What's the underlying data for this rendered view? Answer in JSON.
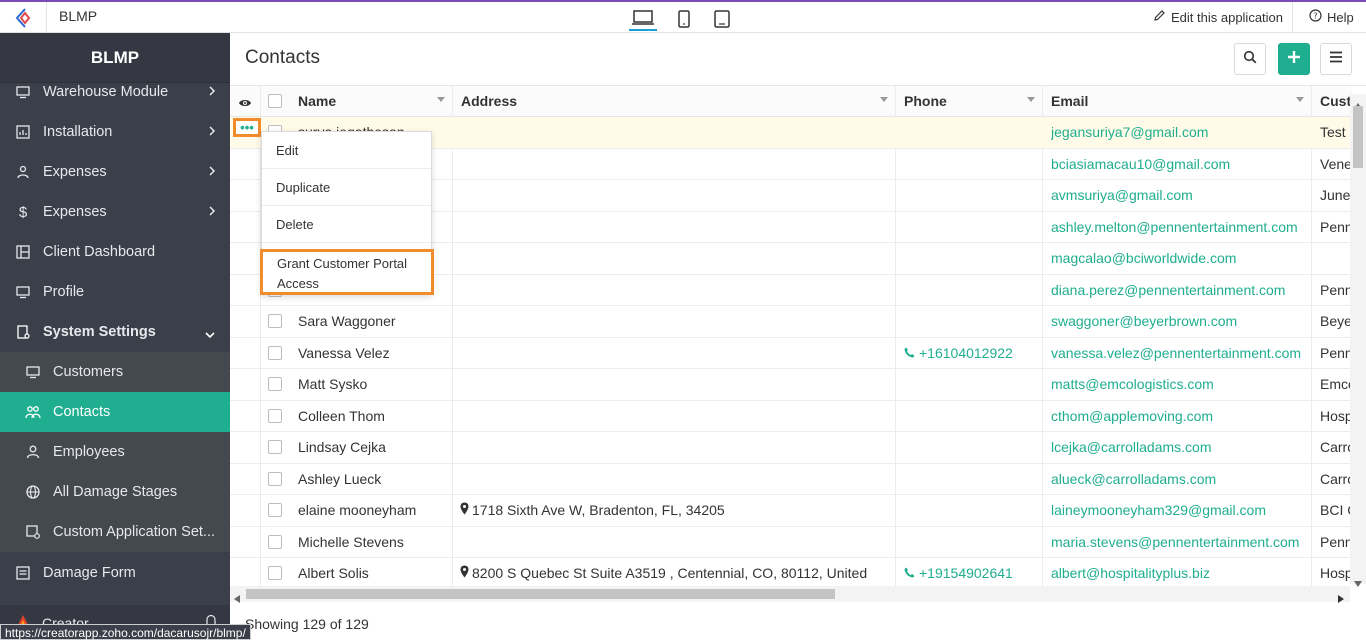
{
  "app": {
    "name": "BLMP",
    "edit_label": "Edit this application",
    "help_label": "Help"
  },
  "sidebar": {
    "brand": "BLMP",
    "items": [
      {
        "label": "Warehouse Module",
        "icon": "monitor-icon"
      },
      {
        "label": "Installation",
        "icon": "chart-icon"
      },
      {
        "label": "Expenses",
        "icon": "people-icon"
      },
      {
        "label": "Expenses",
        "icon": "dollar-icon"
      },
      {
        "label": "Client Dashboard",
        "icon": "dashboard-icon"
      },
      {
        "label": "Profile",
        "icon": "monitor-icon"
      },
      {
        "label": "System Settings",
        "icon": "settings-doc-icon"
      },
      {
        "label": "Customers",
        "icon": "monitor-icon"
      },
      {
        "label": "Contacts",
        "icon": "contacts-icon"
      },
      {
        "label": "Employees",
        "icon": "user-icon"
      },
      {
        "label": "All Damage Stages",
        "icon": "globe-icon"
      },
      {
        "label": "Custom Application Set...",
        "icon": "settings-icon"
      },
      {
        "label": "Damage Form",
        "icon": "form-icon"
      }
    ],
    "creator_label": "Creator"
  },
  "page": {
    "title": "Contacts",
    "footer": "Showing 129 of 129"
  },
  "grid": {
    "columns": [
      "Name",
      "Address",
      "Phone",
      "Email",
      "Cust"
    ],
    "rows": [
      {
        "name": "surya jegathesan",
        "address": "",
        "phone": "",
        "email": "jegansuriya7@gmail.com",
        "cust": "Test"
      },
      {
        "name": "",
        "address": "",
        "phone": "",
        "email": "bciasiamacau10@gmail.com",
        "cust": "Vene"
      },
      {
        "name": "",
        "address": "",
        "phone": "",
        "email": "avmsuriya@gmail.com",
        "cust": "June"
      },
      {
        "name": "",
        "address": "",
        "phone": "",
        "email": "ashley.melton@pennentertainment.com",
        "cust": "Penn"
      },
      {
        "name": "",
        "address": "",
        "phone": "",
        "email": "magcalao@bciworldwide.com",
        "cust": ""
      },
      {
        "name": "",
        "address": "",
        "phone": "",
        "email": "diana.perez@pennentertainment.com",
        "cust": "Penn"
      },
      {
        "name": "Sara Waggoner",
        "address": "",
        "phone": "",
        "email": "swaggoner@beyerbrown.com",
        "cust": "Beye"
      },
      {
        "name": "Vanessa Velez",
        "address": "",
        "phone": "+16104012922",
        "email": "vanessa.velez@pennentertainment.com",
        "cust": "Penn"
      },
      {
        "name": "Matt Sysko",
        "address": "",
        "phone": "",
        "email": "matts@emcologistics.com",
        "cust": "Emco"
      },
      {
        "name": "Colleen Thom",
        "address": "",
        "phone": "",
        "email": "cthom@applemoving.com",
        "cust": "Hosp"
      },
      {
        "name": "Lindsay Cejka",
        "address": "",
        "phone": "",
        "email": "lcejka@carrolladams.com",
        "cust": "Carro"
      },
      {
        "name": "Ashley Lueck",
        "address": "",
        "phone": "",
        "email": "alueck@carrolladams.com",
        "cust": "Carro"
      },
      {
        "name": "elaine mooneyham",
        "address": "1718 Sixth Ave W, Bradenton, FL, 34205",
        "phone": "",
        "email": "laineymooneyham329@gmail.com",
        "cust": "BCI C"
      },
      {
        "name": "Michelle Stevens",
        "address": "",
        "phone": "",
        "email": "maria.stevens@pennentertainment.com",
        "cust": "Penn"
      },
      {
        "name": "Albert Solis",
        "address": "8200 S Quebec St Suite A3519 , Centennial, CO, 80112, United",
        "phone": "+19154902641",
        "email": "albert@hospitalityplus.biz",
        "cust": "Hosp"
      }
    ]
  },
  "context_menu": {
    "items": [
      "Edit",
      "Duplicate",
      "Delete",
      "Grant Customer Portal Access"
    ]
  },
  "status_url": "https://creatorapp.zoho.com/dacarusojr/blmp/",
  "colors": {
    "accent": "#1fae8f",
    "sidebar": "#3b3f4a",
    "highlight": "#f08c2c"
  }
}
